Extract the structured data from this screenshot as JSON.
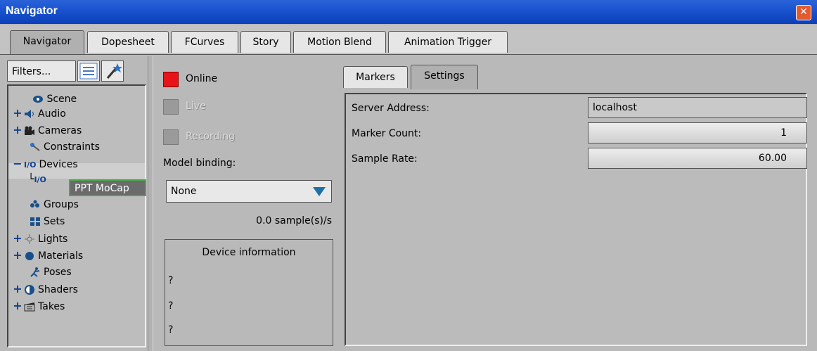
{
  "window": {
    "title": "Navigator",
    "close_glyph": "✕"
  },
  "main_tabs": [
    {
      "label": "Navigator",
      "active": true
    },
    {
      "label": "Dopesheet",
      "active": false
    },
    {
      "label": "FCurves",
      "active": false
    },
    {
      "label": "Story",
      "active": false
    },
    {
      "label": "Motion Blend",
      "active": false
    },
    {
      "label": "Animation Trigger",
      "active": false
    }
  ],
  "left": {
    "filters_label": "Filters...",
    "tree": [
      {
        "label": "Scene",
        "expander": "",
        "icon": "scene-icon"
      },
      {
        "label": "Audio",
        "expander": "+",
        "icon": "audio-icon"
      },
      {
        "label": "Cameras",
        "expander": "+",
        "icon": "camera-icon"
      },
      {
        "label": "Constraints",
        "expander": "",
        "icon": "constraint-icon"
      },
      {
        "label": "Devices",
        "expander": "−",
        "icon": "io-icon",
        "icon_text": "I/O"
      },
      {
        "label": "Groups",
        "expander": "",
        "icon": "groups-icon"
      },
      {
        "label": "Sets",
        "expander": "",
        "icon": "sets-icon"
      },
      {
        "label": "Lights",
        "expander": "+",
        "icon": "light-icon"
      },
      {
        "label": "Materials",
        "expander": "+",
        "icon": "material-icon"
      },
      {
        "label": "Poses",
        "expander": "",
        "icon": "pose-icon"
      },
      {
        "label": "Shaders",
        "expander": "+",
        "icon": "shader-icon"
      },
      {
        "label": "Takes",
        "expander": "+",
        "icon": "takes-icon"
      }
    ],
    "device_child": {
      "label": "PPT MoCap",
      "icon_text": "I/O",
      "connector": "└"
    }
  },
  "middle": {
    "online_label": "Online",
    "live_label": "Live",
    "recording_label": "Recording",
    "model_binding_label": "Model binding:",
    "model_binding_value": "None",
    "sample_rate_text": "0.0 sample(s)/s",
    "device_info_title": "Device information",
    "device_info_lines": [
      "?",
      "?",
      "?"
    ],
    "colors": {
      "online": "#e8141a"
    }
  },
  "right": {
    "tabs": [
      {
        "label": "Markers",
        "active": false
      },
      {
        "label": "Settings",
        "active": true
      }
    ],
    "settings": {
      "server_address_label": "Server Address:",
      "server_address_value": "localhost",
      "marker_count_label": "Marker Count:",
      "marker_count_value": "1",
      "sample_rate_label": "Sample Rate:",
      "sample_rate_value": "60.00"
    }
  }
}
